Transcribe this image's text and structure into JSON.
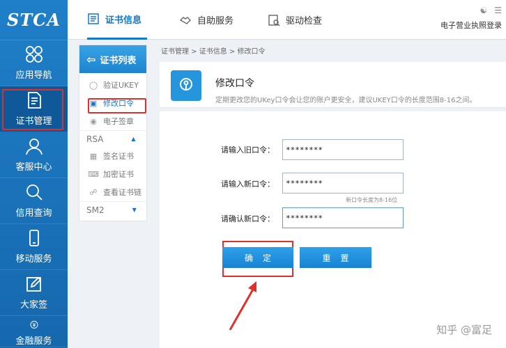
{
  "logo": "STCA",
  "nav": [
    {
      "label": "应用导航",
      "icon": "grid-icon"
    },
    {
      "label": "证书管理",
      "icon": "document-icon"
    },
    {
      "label": "客服中心",
      "icon": "user-icon"
    },
    {
      "label": "信用查询",
      "icon": "search-icon"
    },
    {
      "label": "移动服务",
      "icon": "phone-icon"
    },
    {
      "label": "大家签",
      "icon": "edit-icon"
    },
    {
      "label": "金融服务",
      "icon": "finance-icon"
    }
  ],
  "tabs": [
    {
      "label": "证书信息",
      "icon": "list-icon"
    },
    {
      "label": "自助服务",
      "icon": "handshake-icon"
    },
    {
      "label": "驱动检查",
      "icon": "check-icon"
    }
  ],
  "top_link": "电子营业执照登录",
  "sublist": {
    "title": "证书列表",
    "items": [
      {
        "label": "验证UKEY",
        "icon": "shield-icon"
      },
      {
        "label": "修改口令",
        "icon": "lock-icon"
      },
      {
        "label": "电子签章",
        "icon": "seal-icon"
      }
    ],
    "group_rsa": "RSA",
    "items2": [
      {
        "label": "签名证书",
        "icon": "chart-icon"
      },
      {
        "label": "加密证书",
        "icon": "keyboard-icon"
      },
      {
        "label": "查看证书链",
        "icon": "link-icon"
      }
    ],
    "group_sm2": "SM2"
  },
  "breadcrumb": "证书管理 > 证书信息 > 修改口令",
  "header": {
    "title": "修改口令",
    "desc": "定期更改您的UKey口令会让您的账户更安全，建议UKEY口令的长度范围8-16之间。"
  },
  "form": {
    "old_label": "请输入旧口令：",
    "old_value": "********",
    "new_label": "请输入新口令：",
    "new_value": "********",
    "hint": "新口令长度为8-16位",
    "confirm_label": "请确认新口令：",
    "confirm_value": "********",
    "ok": "确定",
    "reset": "重置"
  },
  "watermark": "知乎 @富足",
  "colors": {
    "primary": "#1677c9",
    "highlight": "#e0302c"
  }
}
